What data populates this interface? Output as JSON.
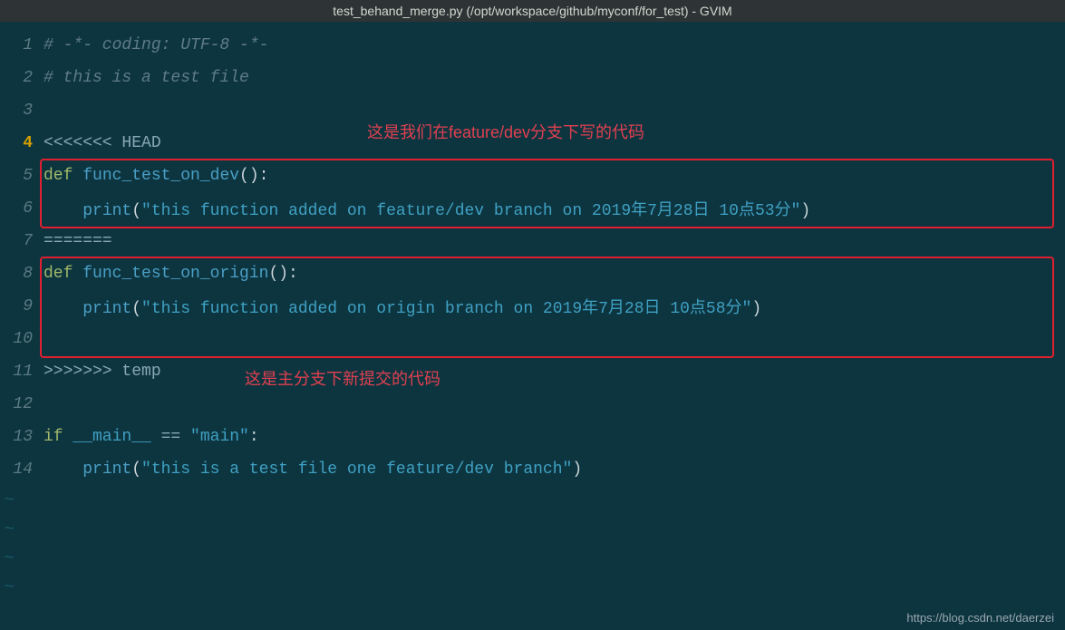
{
  "titlebar": "test_behand_merge.py (/opt/workspace/github/myconf/for_test) - GVIM",
  "current_line": 4,
  "lines": {
    "l1": {
      "no": "1",
      "segs": [
        {
          "cls": "comment",
          "t": "# -*- coding: UTF-8 -*-"
        }
      ]
    },
    "l2": {
      "no": "2",
      "segs": [
        {
          "cls": "comment",
          "t": "# this is a test file"
        }
      ]
    },
    "l3": {
      "no": "3",
      "segs": []
    },
    "l4": {
      "no": "4",
      "segs": [
        {
          "cls": "conflict-cur",
          "t": "<<<<<<< HEAD"
        }
      ]
    },
    "l5": {
      "no": "5",
      "segs": [
        {
          "cls": "kw-def",
          "t": "def "
        },
        {
          "cls": "func-name",
          "t": "func_test_on_dev"
        },
        {
          "cls": "paren",
          "t": "():"
        }
      ]
    },
    "l6": {
      "no": "6",
      "segs": [
        {
          "cls": "text-norm",
          "t": "    "
        },
        {
          "cls": "ident",
          "t": "print"
        },
        {
          "cls": "paren",
          "t": "("
        },
        {
          "cls": "string",
          "t": "\"this function added on feature/dev branch on 2019年7月28日 10点53分\""
        },
        {
          "cls": "paren",
          "t": ")"
        }
      ]
    },
    "l7": {
      "no": "7",
      "segs": [
        {
          "cls": "text-norm",
          "t": "======="
        }
      ]
    },
    "l8": {
      "no": "8",
      "segs": [
        {
          "cls": "kw-def",
          "t": "def "
        },
        {
          "cls": "func-name",
          "t": "func_test_on_origin"
        },
        {
          "cls": "paren",
          "t": "():"
        }
      ]
    },
    "l9": {
      "no": "9",
      "segs": [
        {
          "cls": "text-norm",
          "t": "    "
        },
        {
          "cls": "ident",
          "t": "print"
        },
        {
          "cls": "paren",
          "t": "("
        },
        {
          "cls": "string",
          "t": "\"this function added on origin branch on 2019年7月28日 10点58分\""
        },
        {
          "cls": "paren",
          "t": ")"
        }
      ]
    },
    "l10": {
      "no": "10",
      "segs": []
    },
    "l11": {
      "no": "11",
      "segs": [
        {
          "cls": "text-norm",
          "t": ">>>>>>> temp"
        }
      ]
    },
    "l12": {
      "no": "12",
      "segs": []
    },
    "l13": {
      "no": "13",
      "segs": [
        {
          "cls": "kw-if",
          "t": "if "
        },
        {
          "cls": "dunder",
          "t": "__main__"
        },
        {
          "cls": "text-norm",
          "t": " == "
        },
        {
          "cls": "string",
          "t": "\"main\""
        },
        {
          "cls": "paren",
          "t": ":"
        }
      ]
    },
    "l14": {
      "no": "14",
      "segs": [
        {
          "cls": "text-norm",
          "t": "    "
        },
        {
          "cls": "ident",
          "t": "print"
        },
        {
          "cls": "paren",
          "t": "("
        },
        {
          "cls": "string",
          "t": "\"this is a test file one feature/dev branch\""
        },
        {
          "cls": "paren",
          "t": ")"
        }
      ]
    }
  },
  "annotations": {
    "top": "这是我们在feature/dev分支下写的代码",
    "bottom": "这是主分支下新提交的代码"
  },
  "watermark": "https://blog.csdn.net/daerzei",
  "tilde": "~"
}
